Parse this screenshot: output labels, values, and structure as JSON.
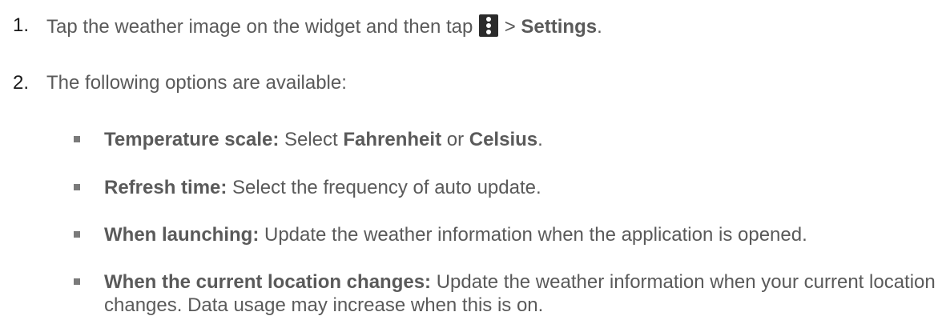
{
  "steps": [
    {
      "number": "1.",
      "text_before_icon": "Tap the weather image on the widget and then tap",
      "icon": "more-vertical-icon",
      "text_after_icon": " > ",
      "bold": "Settings",
      "end": "."
    },
    {
      "number": "2.",
      "text": "The following options are available:"
    }
  ],
  "options": [
    {
      "label": "Temperature scale:",
      "text_parts": [
        " Select ",
        "Fahrenheit",
        " or ",
        "Celsius",
        "."
      ]
    },
    {
      "label": "Refresh time:",
      "text": " Select the frequency of auto update."
    },
    {
      "label": "When launching:",
      "text": " Update the weather information when the application is opened."
    },
    {
      "label": "When the current location changes:",
      "text": " Update the weather information when your current location changes. Data usage may increase when this is on."
    }
  ]
}
